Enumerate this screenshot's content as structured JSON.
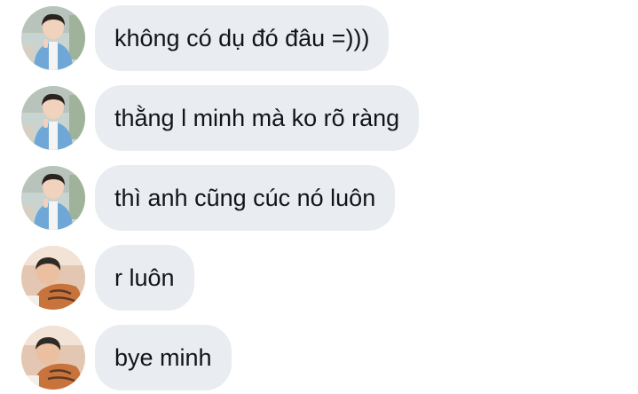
{
  "conversation": {
    "messages": [
      {
        "text": "không có dụ đó đâu =)))",
        "avatar": "avatar-photo-person-blue-shirt"
      },
      {
        "text": "thằng l minh mà ko rõ ràng",
        "avatar": "avatar-photo-person-blue-shirt"
      },
      {
        "text": "thì anh cũng cúc nó luôn",
        "avatar": "avatar-photo-person-blue-shirt"
      },
      {
        "text": "r luôn",
        "avatar": "avatar-photo-person-lying"
      },
      {
        "text": "bye minh",
        "avatar": "avatar-photo-person-lying"
      }
    ]
  },
  "colors": {
    "background": "#ffffff",
    "bubble": "#e9ecf0",
    "text": "#111418"
  }
}
